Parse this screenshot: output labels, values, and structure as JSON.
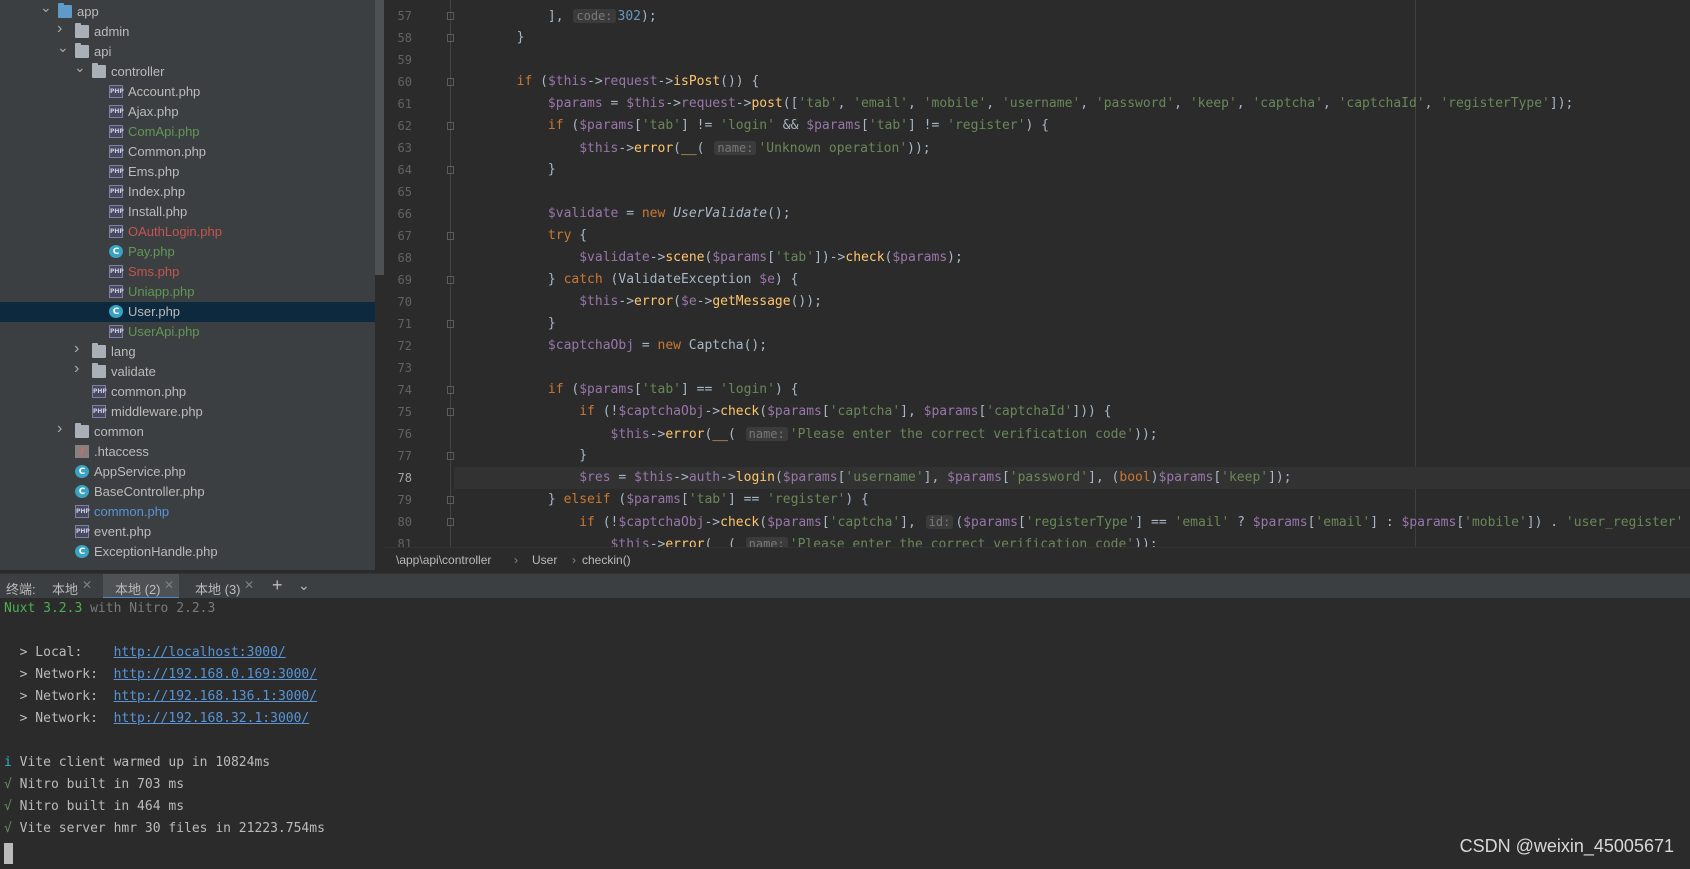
{
  "tree": {
    "items": [
      {
        "label": "app",
        "icon": "folder-icon",
        "level": 0,
        "arrow": "down",
        "color": "#bbbbbb"
      },
      {
        "label": "admin",
        "icon": "folder-icon",
        "level": 1,
        "arrow": "right",
        "color": "#bbbbbb"
      },
      {
        "label": "api",
        "icon": "folder-icon",
        "level": 1,
        "arrow": "down",
        "color": "#bbbbbb"
      },
      {
        "label": "controller",
        "icon": "folder-icon",
        "level": 2,
        "arrow": "down",
        "color": "#bbbbbb"
      },
      {
        "label": "Account.php",
        "icon": "php-file-icon",
        "level": 3,
        "color": "#bbbbbb"
      },
      {
        "label": "Ajax.php",
        "icon": "php-file-icon",
        "level": 3,
        "color": "#bbbbbb"
      },
      {
        "label": "ComApi.php",
        "icon": "php-file-icon",
        "level": 3,
        "color": "#629755"
      },
      {
        "label": "Common.php",
        "icon": "php-file-icon",
        "level": 3,
        "color": "#bbbbbb"
      },
      {
        "label": "Ems.php",
        "icon": "php-file-icon",
        "level": 3,
        "color": "#bbbbbb"
      },
      {
        "label": "Index.php",
        "icon": "php-file-icon",
        "level": 3,
        "color": "#bbbbbb"
      },
      {
        "label": "Install.php",
        "icon": "php-file-icon",
        "level": 3,
        "color": "#bbbbbb"
      },
      {
        "label": "OAuthLogin.php",
        "icon": "php-file-icon",
        "level": 3,
        "color": "#c75450"
      },
      {
        "label": "Pay.php",
        "icon": "php-class-icon",
        "level": 3,
        "color": "#629755"
      },
      {
        "label": "Sms.php",
        "icon": "php-file-icon",
        "level": 3,
        "color": "#c75450"
      },
      {
        "label": "Uniapp.php",
        "icon": "php-file-icon",
        "level": 3,
        "color": "#629755"
      },
      {
        "label": "User.php",
        "icon": "php-class-icon",
        "level": 3,
        "color": "#bbbbbb",
        "selected": true
      },
      {
        "label": "UserApi.php",
        "icon": "php-file-icon",
        "level": 3,
        "color": "#629755"
      },
      {
        "label": "lang",
        "icon": "folder-icon",
        "level": 2,
        "arrow": "right",
        "color": "#bbbbbb"
      },
      {
        "label": "validate",
        "icon": "folder-icon",
        "level": 2,
        "arrow": "right",
        "color": "#bbbbbb"
      },
      {
        "label": "common.php",
        "icon": "php-file-icon",
        "level": 2,
        "color": "#bbbbbb"
      },
      {
        "label": "middleware.php",
        "icon": "php-file-icon",
        "level": 2,
        "color": "#bbbbbb"
      },
      {
        "label": "common",
        "icon": "folder-icon",
        "level": 1,
        "arrow": "right",
        "color": "#bbbbbb"
      },
      {
        "label": ".htaccess",
        "icon": "htaccess-icon",
        "level": 1,
        "color": "#bbbbbb"
      },
      {
        "label": "AppService.php",
        "icon": "php-class-icon",
        "level": 1,
        "color": "#bbbbbb"
      },
      {
        "label": "BaseController.php",
        "icon": "php-class-icon",
        "level": 1,
        "color": "#bbbbbb"
      },
      {
        "label": "common.php",
        "icon": "php-file-icon",
        "level": 1,
        "color": "#5894d6"
      },
      {
        "label": "event.php",
        "icon": "php-file-icon",
        "level": 1,
        "color": "#bbbbbb"
      },
      {
        "label": "ExceptionHandle.php",
        "icon": "php-class-icon",
        "level": 1,
        "color": "#bbbbbb"
      }
    ]
  },
  "editor": {
    "current_line": "78",
    "lines": [
      {
        "num": "57",
        "fold": true,
        "html": "            ], <span class=\"hint\">code:</span><span class=\"n\">302</span>);"
      },
      {
        "num": "58",
        "fold": true,
        "html": "        }"
      },
      {
        "num": "59",
        "fold": false,
        "html": ""
      },
      {
        "num": "60",
        "fold": true,
        "html": "        <span class=\"k\">if</span> (<span class=\"v\">$this</span>-&gt;<span class=\"v\">request</span>-&gt;<span class=\"f\">isPost</span>()) {"
      },
      {
        "num": "61",
        "fold": false,
        "html": "            <span class=\"v\">$params</span> = <span class=\"v\">$this</span>-&gt;<span class=\"v\">request</span>-&gt;<span class=\"f\">post</span>([<span class=\"s\">'tab'</span>, <span class=\"s\">'email'</span>, <span class=\"s\">'mobile'</span>, <span class=\"s\">'username'</span>, <span class=\"s\">'password'</span>, <span class=\"s\">'keep'</span>, <span class=\"s\">'captcha'</span>, <span class=\"s\">'captchaId'</span>, <span class=\"s\">'registerType'</span>]);"
      },
      {
        "num": "62",
        "fold": true,
        "html": "            <span class=\"k\">if</span> (<span class=\"v\">$params</span>[<span class=\"s\">'tab'</span>] != <span class=\"s\">'login'</span> &amp;&amp; <span class=\"v\">$params</span>[<span class=\"s\">'tab'</span>] != <span class=\"s\">'register'</span>) {"
      },
      {
        "num": "63",
        "fold": false,
        "html": "                <span class=\"v\">$this</span>-&gt;<span class=\"f\">error</span>(<span class=\"f\">__</span>( <span class=\"hint\">name:</span><span class=\"s\">'Unknown operation'</span>));"
      },
      {
        "num": "64",
        "fold": true,
        "html": "            }"
      },
      {
        "num": "65",
        "fold": false,
        "html": ""
      },
      {
        "num": "66",
        "fold": false,
        "html": "            <span class=\"v\">$validate</span> = <span class=\"k\">new</span> <span class=\"it\">UserValidate</span>();"
      },
      {
        "num": "67",
        "fold": true,
        "html": "            <span class=\"k\">try</span> {"
      },
      {
        "num": "68",
        "fold": false,
        "html": "                <span class=\"v\">$validate</span>-&gt;<span class=\"f\">scene</span>(<span class=\"v\">$params</span>[<span class=\"s\">'tab'</span>])-&gt;<span class=\"f\">check</span>(<span class=\"v\">$params</span>);"
      },
      {
        "num": "69",
        "fold": true,
        "html": "            } <span class=\"k\">catch</span> (ValidateException <span class=\"v\">$e</span>) {"
      },
      {
        "num": "70",
        "fold": false,
        "html": "                <span class=\"v\">$this</span>-&gt;<span class=\"f\">error</span>(<span class=\"v\">$e</span>-&gt;<span class=\"f\">getMessage</span>());"
      },
      {
        "num": "71",
        "fold": true,
        "html": "            }"
      },
      {
        "num": "72",
        "fold": false,
        "html": "            <span class=\"v\">$captchaObj</span> = <span class=\"k\">new</span> Captcha();"
      },
      {
        "num": "73",
        "fold": false,
        "html": ""
      },
      {
        "num": "74",
        "fold": true,
        "html": "            <span class=\"k\">if</span> (<span class=\"v\">$params</span>[<span class=\"s\">'tab'</span>] == <span class=\"s\">'login'</span>) {"
      },
      {
        "num": "75",
        "fold": true,
        "html": "                <span class=\"k\">if</span> (!<span class=\"v\">$captchaObj</span>-&gt;<span class=\"f\">check</span>(<span class=\"v\">$params</span>[<span class=\"s\">'captcha'</span>], <span class=\"v\">$params</span>[<span class=\"s\">'captchaId'</span>])) {"
      },
      {
        "num": "76",
        "fold": false,
        "html": "                    <span class=\"v\">$this</span>-&gt;<span class=\"f\">error</span>(<span class=\"f\">__</span>( <span class=\"hint\">name:</span><span class=\"s\">'Please enter the correct verification code'</span>));"
      },
      {
        "num": "77",
        "fold": true,
        "html": "                }"
      },
      {
        "num": "78",
        "fold": false,
        "html": "                <span class=\"v\">$res</span> = <span class=\"v\">$this</span>-&gt;<span class=\"v\">auth</span>-&gt;<span class=\"f\">login</span>(<span class=\"v\">$params</span>[<span class=\"s\">'username'</span>], <span class=\"v\">$params</span>[<span class=\"s\">'password'</span>], (<span class=\"k\">bool</span>)<span class=\"v\">$params</span>[<span class=\"s\">'keep'</span>]);"
      },
      {
        "num": "79",
        "fold": true,
        "html": "            } <span class=\"k\">elseif</span> (<span class=\"v\">$params</span>[<span class=\"s\">'tab'</span>] == <span class=\"s\">'register'</span>) {"
      },
      {
        "num": "80",
        "fold": true,
        "html": "                <span class=\"k\">if</span> (!<span class=\"v\">$captchaObj</span>-&gt;<span class=\"f\">check</span>(<span class=\"v\">$params</span>[<span class=\"s\">'captcha'</span>], <span class=\"hint\">id:</span>(<span class=\"v\">$params</span>[<span class=\"s\">'registerType'</span>] == <span class=\"s\">'email'</span> ? <span class=\"v\">$params</span>[<span class=\"s\">'email'</span>] : <span class=\"v\">$params</span>[<span class=\"s\">'mobile'</span>]) . <span class=\"s\">'user_register'</span>"
      },
      {
        "num": "81",
        "fold": false,
        "html": "                    <span class=\"v\">$this</span>-&gt;<span class=\"f\">error</span>(<span class=\"f\">__</span>( <span class=\"hint\">name:</span><span class=\"s\">'Please enter the correct verification code'</span>));"
      }
    ]
  },
  "breadcrumb": {
    "path": "\\app\\api\\controller",
    "sep": "›",
    "class_name": "User",
    "method": "checkin()"
  },
  "terminal_tabs": {
    "label": "终端:",
    "tabs": [
      {
        "label": "本地",
        "active": false
      },
      {
        "label": "本地 (2)",
        "active": true
      },
      {
        "label": "本地 (3)",
        "active": false
      }
    ],
    "add_icon": "+",
    "dropdown_icon": "chevron-down-icon"
  },
  "terminal": {
    "nuxt": "Nuxt 3.2.3",
    "nitro": " with Nitro 2.2.3",
    "local_label": "  > Local:    ",
    "local_url": "http://localhost:3000/",
    "net1_label": "  > Network:  ",
    "net1_url": "http://192.168.0.169:3000/",
    "net2_label": "  > Network:  ",
    "net2_url": "http://192.168.136.1:3000/",
    "net3_label": "  > Network:  ",
    "net3_url": "http://192.168.32.1:3000/",
    "info_mark": "i",
    "info_text": " Vite client warmed up in 10824ms",
    "check_mark": "√",
    "line2": " Nitro built in 703 ms",
    "line3": " Nitro built in 464 ms",
    "line4": " Vite server hmr 30 files in 21223.754ms"
  },
  "watermark": "CSDN @weixin_45005671"
}
